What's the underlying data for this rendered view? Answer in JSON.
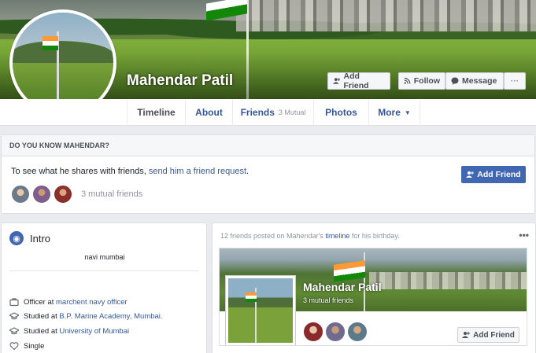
{
  "colors": {
    "link": "#365899",
    "primary_button": "#4267b2",
    "background": "#e9ebee"
  },
  "profile": {
    "name": "Mahendar Patil"
  },
  "actions": {
    "add_friend": "Add Friend",
    "follow": "Follow",
    "message": "Message",
    "more": "···"
  },
  "nav": {
    "tabs": [
      {
        "label": "Timeline"
      },
      {
        "label": "About"
      },
      {
        "label": "Friends",
        "sub": "3 Mutual"
      },
      {
        "label": "Photos"
      },
      {
        "label": "More"
      }
    ]
  },
  "know": {
    "heading": "DO YOU KNOW MAHENDAR?",
    "text_prefix": "To see what he shares with friends, ",
    "link": "send him a friend request",
    "text_suffix": ".",
    "button": "Add Friend",
    "mutual": "3 mutual friends"
  },
  "intro": {
    "title": "Intro",
    "bio": "navi mumbai",
    "work_prefix": "Officer at ",
    "work_link": "marchent navy officer",
    "edu1_prefix": "Studied at ",
    "edu1_link": "B.P. Marine Academy, Mumbai.",
    "edu2_prefix": "Studied at ",
    "edu2_link": "University of Mumbai",
    "relationship": "Single"
  },
  "post": {
    "text_prefix": "12 friends posted on Mahendar's ",
    "text_link": "timeline",
    "text_suffix": " for his birthday.",
    "more": "•••",
    "card_name": "Mahendar Patil",
    "card_mutual": "3 mutual friends",
    "card_button": "Add Friend"
  }
}
